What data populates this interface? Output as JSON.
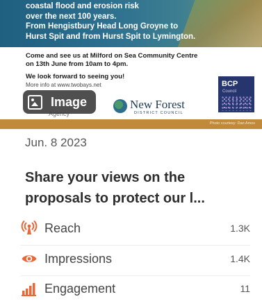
{
  "post": {
    "image": {
      "headline_lines": [
        "coastal flood and erosion risk",
        "over the next 100 years.",
        "From Hengistbury Head Long Groyne to",
        "Hurst Spit and from Hurst Spit to Lymington."
      ],
      "invite_line_1": "Come and see us at Milford on Sea Community Centre",
      "invite_line_2": "on 13th June from 10am to 4pm.",
      "look_forward": "We look forward to seeing you!",
      "more_info": "More info at www.twobays.net",
      "logo_new_forest": "New Forest",
      "logo_new_forest_sub": "DISTRICT COUNCIL",
      "logo_bcp": "BCP",
      "logo_bcp_sub": "Council",
      "agency_text": "Agency",
      "photo_credit": "Photo courtesy: Dan Amos",
      "badge_label": "Image"
    },
    "date": "Jun. 8 2023",
    "title": "Share your views on the proposals to protect our l..."
  },
  "metrics": [
    {
      "icon": "broadcast-icon",
      "label": "Reach",
      "value": "1.3K"
    },
    {
      "icon": "eye-icon",
      "label": "Impressions",
      "value": "1.4K"
    },
    {
      "icon": "bar-chart-icon",
      "label": "Engagement",
      "value": "11"
    }
  ],
  "colors": {
    "accent": "#e8683a",
    "image_banner": "#2c6f8f",
    "image_bar": "#c08a3a",
    "bcp_logo": "#27356e"
  }
}
